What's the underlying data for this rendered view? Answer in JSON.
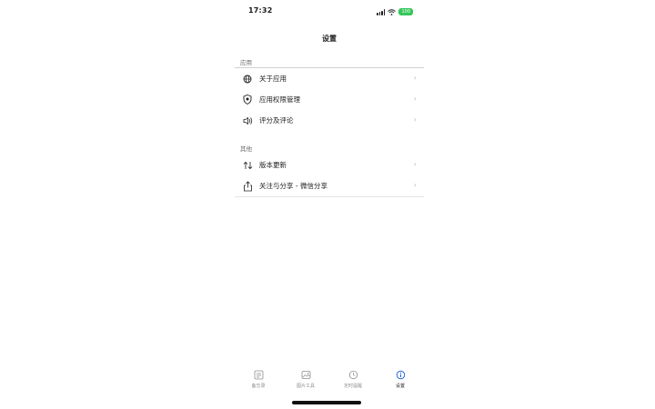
{
  "status_bar": {
    "time": "17:32",
    "battery": "100"
  },
  "nav": {
    "title": "设置"
  },
  "sections": [
    {
      "header": "应用",
      "items": [
        {
          "icon": "globe-icon",
          "label": "关于应用"
        },
        {
          "icon": "shield-icon",
          "label": "应用权限管理"
        },
        {
          "icon": "speaker-icon",
          "label": "评分及评论"
        }
      ]
    },
    {
      "header": "其他",
      "items": [
        {
          "icon": "sort-arrows-icon",
          "label": "版本更新"
        },
        {
          "icon": "share-icon",
          "label": "关注与分享 - 微信分享"
        }
      ]
    }
  ],
  "tabbar": {
    "tabs": [
      {
        "icon": "notes-icon",
        "label": "备忘录"
      },
      {
        "icon": "photo-icon",
        "label": "图片工具"
      },
      {
        "icon": "clock-icon",
        "label": "定时提醒"
      },
      {
        "icon": "info-icon",
        "label": "设置",
        "active": true
      }
    ]
  },
  "colors": {
    "accent": "#1e63d6",
    "battery": "#34c759",
    "separator": "#d1d1d6"
  }
}
